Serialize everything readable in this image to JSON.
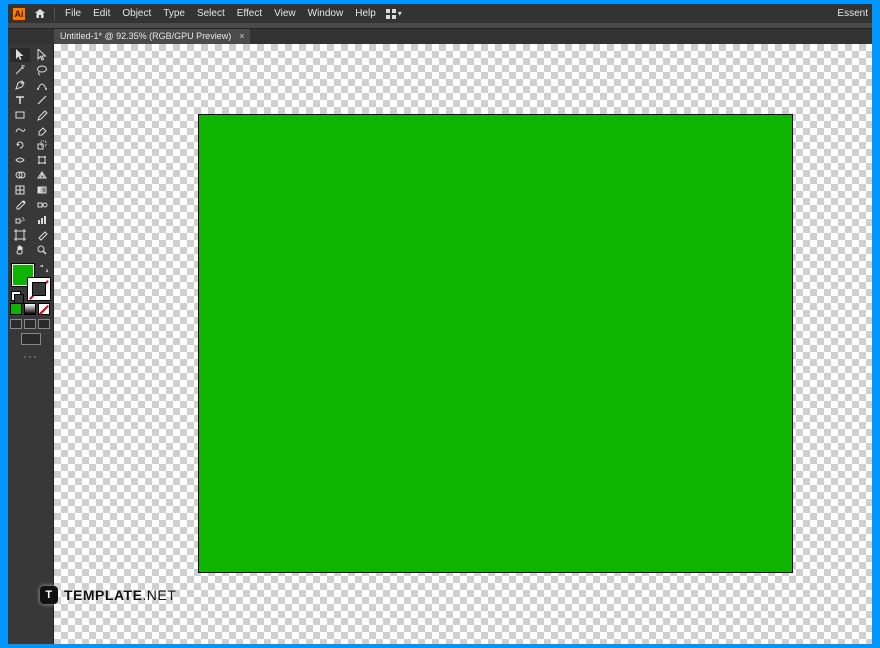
{
  "app": {
    "icon_letter": "Ai",
    "right_label": "Essent"
  },
  "menu": {
    "items": [
      "File",
      "Edit",
      "Object",
      "Type",
      "Select",
      "Effect",
      "View",
      "Window",
      "Help"
    ]
  },
  "tab": {
    "title": "Untitled-1* @ 92.35% (RGB/GPU Preview)",
    "close": "×"
  },
  "colors": {
    "fill": "#0db500",
    "stroke": "none"
  },
  "tools": {
    "left": [
      "selection",
      "pen",
      "type",
      "rectangle",
      "paintbrush",
      "rotate",
      "width",
      "shape-builder",
      "mesh",
      "eyedropper",
      "column-graph",
      "slice",
      "hand"
    ],
    "right": [
      "direct-selection",
      "curvature",
      "line-segment",
      "eraser",
      "scissors",
      "scale",
      "free-transform",
      "perspective",
      "gradient",
      "blend",
      "symbol-sprayer",
      "artboard",
      "zoom"
    ]
  },
  "watermark": {
    "logo": "T",
    "text_bold": "TEMPLATE",
    "text_thin": ".NET"
  }
}
